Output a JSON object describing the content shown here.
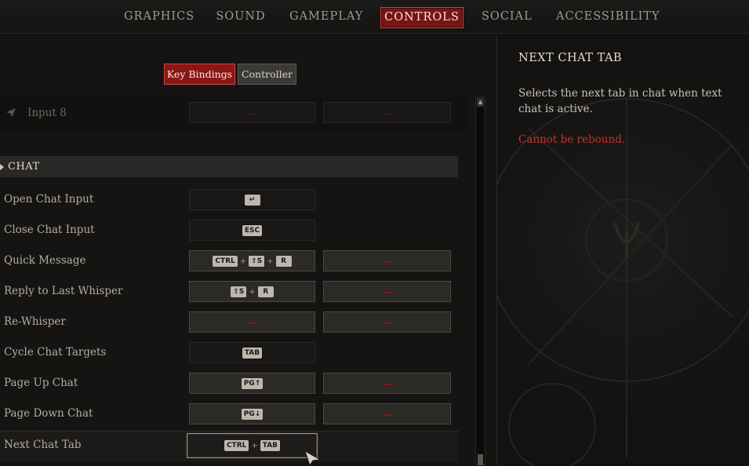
{
  "top_tabs": [
    {
      "label": "GRAPHICS",
      "active": false
    },
    {
      "label": "SOUND",
      "active": false
    },
    {
      "label": "GAMEPLAY",
      "active": false
    },
    {
      "label": "CONTROLS",
      "active": true
    },
    {
      "label": "SOCIAL",
      "active": false
    },
    {
      "label": "ACCESSIBILITY",
      "active": false
    }
  ],
  "sub_tabs": {
    "key_bindings": "Key Bindings",
    "controller": "Controller"
  },
  "input_row": {
    "label": "Input 8"
  },
  "section": {
    "title": "CHAT"
  },
  "bindings": [
    {
      "label": "Open Chat Input",
      "primary": [
        "↵"
      ]
    },
    {
      "label": "Close Chat Input",
      "primary": [
        "ESC"
      ]
    },
    {
      "label": "Quick Message",
      "primary": [
        "CTRL",
        "⇧S",
        "R"
      ]
    },
    {
      "label": "Reply to Last Whisper",
      "primary": [
        "⇧S",
        "R"
      ]
    },
    {
      "label": "Re-Whisper",
      "primary": []
    },
    {
      "label": "Cycle Chat Targets",
      "primary": [
        "TAB"
      ]
    },
    {
      "label": "Page Up Chat",
      "primary": [
        "PG↑"
      ]
    },
    {
      "label": "Page Down Chat",
      "primary": [
        "PG↓"
      ]
    },
    {
      "label": "Next Chat Tab",
      "primary": [
        "CTRL",
        "TAB"
      ]
    }
  ],
  "detail": {
    "title": "NEXT CHAT TAB",
    "description": "Selects the next tab in chat when text chat is active.",
    "warning": "Cannot be rebound."
  },
  "colors": {
    "accent": "#8a1715",
    "warning": "#c8322c"
  }
}
